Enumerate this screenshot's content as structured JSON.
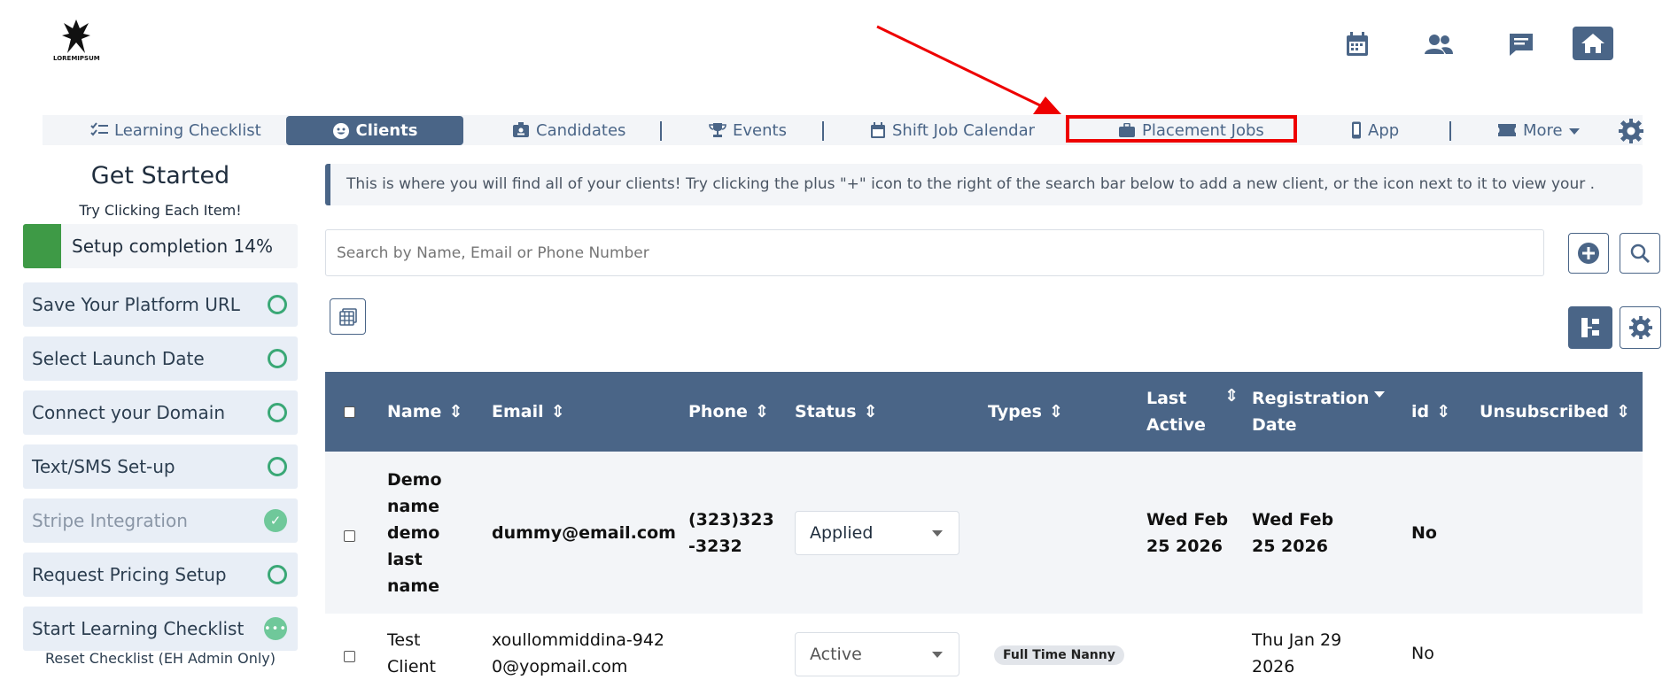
{
  "header": {
    "logo_text": "LOREMIPSUM",
    "icons": [
      "calendar-icon",
      "users-icon",
      "chat-icon",
      "home-icon"
    ]
  },
  "nav": {
    "items": [
      {
        "label": "Learning Checklist",
        "icon": "checklist-icon"
      },
      {
        "label": "Clients",
        "icon": "smile-icon",
        "active": true
      },
      {
        "label": "Candidates",
        "icon": "id-badge-icon"
      },
      {
        "label": "Events",
        "icon": "trophy-icon"
      },
      {
        "label": "Shift Job Calendar",
        "icon": "calendar-icon"
      },
      {
        "label": "Placement Jobs",
        "icon": "briefcase-icon",
        "highlighted": true
      },
      {
        "label": "App",
        "icon": "mobile-icon"
      },
      {
        "label": "More",
        "icon": "ticket-icon"
      }
    ],
    "active_color": "#4a6587",
    "highlight_color": "#ee0000"
  },
  "sidebar": {
    "title": "Get Started",
    "subtitle": "Try Clicking Each Item!",
    "progress_label": "Setup completion 14%",
    "progress_percent": 14,
    "items": [
      {
        "label": "Save Your Platform URL",
        "status": "pending"
      },
      {
        "label": "Select Launch Date",
        "status": "pending"
      },
      {
        "label": "Connect your Domain",
        "status": "pending"
      },
      {
        "label": "Text/SMS Set-up",
        "status": "pending"
      },
      {
        "label": "Stripe Integration",
        "status": "done"
      },
      {
        "label": "Request Pricing Setup",
        "status": "pending"
      },
      {
        "label": "Start Learning Checklist",
        "status": "in-progress"
      }
    ],
    "reset_label": "Reset Checklist (EH Admin Only)"
  },
  "main": {
    "info_text": "This is where you will find all of your clients! Try clicking the plus \"+\" icon to the right of the search bar below to add a new client, or the icon next to it to view your .",
    "search_placeholder": "Search by Name, Email or Phone Number",
    "table": {
      "columns": [
        "Name",
        "Email",
        "Phone",
        "Status",
        "Types",
        "Last Active",
        "Registration Date",
        "id",
        "Unsubscribed"
      ],
      "rows": [
        {
          "name": "Demo name demo last name",
          "email": "dummy@email.com",
          "phone": "(323)323-3232",
          "status": "Applied",
          "types": "",
          "last_active": "Wed Feb 25 2026",
          "registration_date": "Wed Feb 25 2026",
          "id": "No",
          "unsubscribed": ""
        },
        {
          "name": "Test Client",
          "email": "xoullommiddina-9420@yopmail.com",
          "phone": "",
          "status": "Active",
          "types": "Full Time Nanny",
          "last_active": "",
          "registration_date": "Thu Jan 29 2026",
          "id": "No",
          "unsubscribed": ""
        }
      ]
    }
  }
}
